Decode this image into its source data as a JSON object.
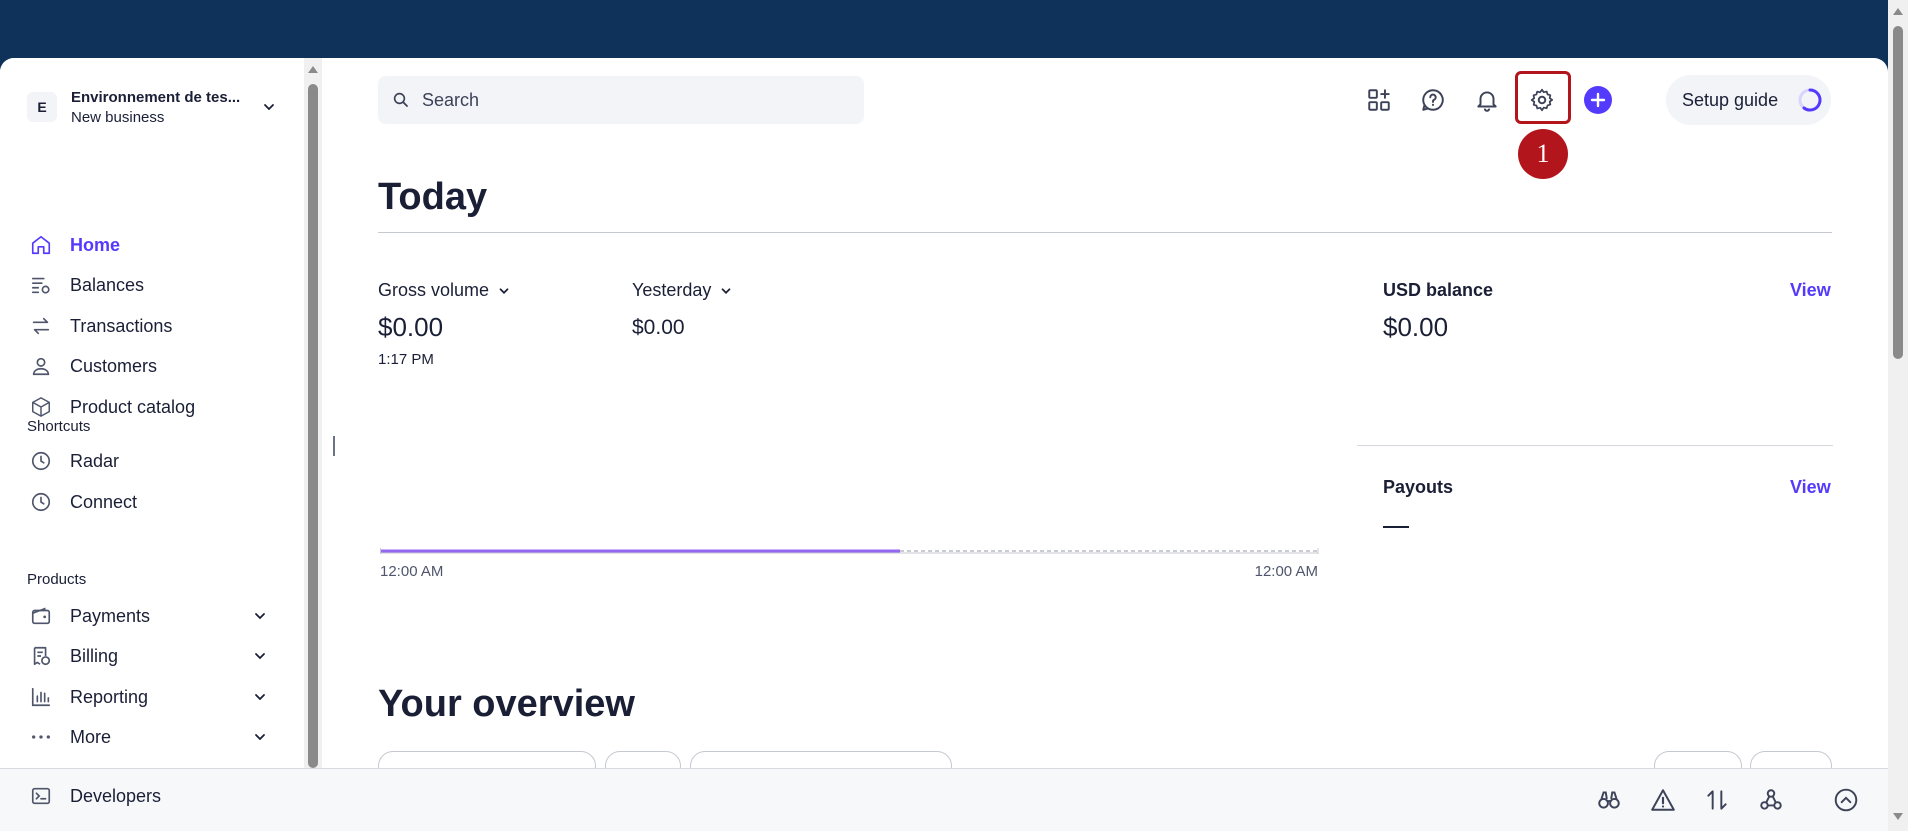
{
  "account": {
    "initial": "E",
    "name": "Environnement de tes...",
    "sub": "New business"
  },
  "nav": {
    "home": "Home",
    "balances": "Balances",
    "transactions": "Transactions",
    "customers": "Customers",
    "product_catalog": "Product catalog"
  },
  "shortcuts": {
    "label": "Shortcuts",
    "radar": "Radar",
    "connect": "Connect"
  },
  "products": {
    "label": "Products",
    "payments": "Payments",
    "billing": "Billing",
    "reporting": "Reporting",
    "more": "More"
  },
  "developers": "Developers",
  "search": {
    "placeholder": "Search"
  },
  "toolbar": {
    "badge_number": "1",
    "setup_guide": "Setup guide"
  },
  "today": {
    "title": "Today",
    "gross_volume_label": "Gross volume",
    "gross_volume_value": "$0.00",
    "gross_volume_time": "1:17 PM",
    "compare_label": "Yesterday",
    "compare_value": "$0.00",
    "chart_start": "12:00 AM",
    "chart_end": "12:00 AM",
    "usd_balance_label": "USD balance",
    "usd_balance_value": "$0.00",
    "usd_view": "View",
    "payouts_label": "Payouts",
    "payouts_view": "View"
  },
  "overview": {
    "title": "Your overview"
  },
  "colors": {
    "accent": "#533afd",
    "header": "#0e3259",
    "highlight": "#b3151c"
  }
}
